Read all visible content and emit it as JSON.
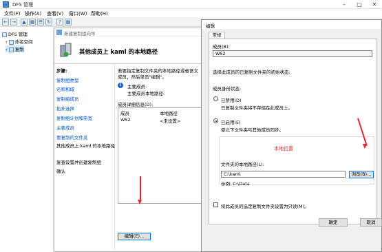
{
  "app": {
    "title": "DFS 管理",
    "menu": [
      "文件(F)",
      "操作(A)",
      "查看(V)",
      "窗口(W)",
      "帮助(H)"
    ]
  },
  "tree": {
    "root": "DFS 管理",
    "children": [
      "命名空间",
      "复制"
    ]
  },
  "wizard": {
    "window_title": "新建复制组向导",
    "heading": "其他成员上 kaml 的本地路径",
    "steps_header": "步骤:",
    "steps": [
      "复制组类型",
      "名称和域",
      "复制组成员",
      "拓扑选择",
      "复制组计划和带宽",
      "主要成员",
      "要复制的文件夹",
      "其他成员上 kaml 的本地路径",
      "复查设置并创建复制组",
      "确认"
    ],
    "intro_line1": "若要指定复制文件夹的本地路径或者该文",
    "intro_line2": "成员，然后单击\"编辑\"。",
    "info_line1": "主要成员:",
    "info_line2": "主要成员本地路径:",
    "details_label": "成员详细信息(D):",
    "columns": [
      "成员",
      "本地路径"
    ],
    "rows": [
      [
        "WS2",
        "<未设置>"
      ]
    ],
    "edit_button": "编辑(E)..."
  },
  "dialog": {
    "title": "编辑",
    "tab": "常规",
    "member_label": "成员(B):",
    "member_value": "WS2",
    "initial_status_hint": "选择此成员的已复制文件夹的初始状态:",
    "status_label": "成员身份状态:",
    "disabled_label": "已禁用(D)",
    "disabled_desc": "已复制文件夹将不存储在此成员上。",
    "enabled_label": "已启用(E)",
    "enabled_desc": "使以下文件夹与其他成员同步。",
    "local_path_label": "文件夹的本地路径(L):",
    "local_path_value": "C:\\kaml",
    "example": "示例: C:\\Data",
    "browse_button": "浏览(B)...",
    "readonly_label": "将此成员的选定复制文件夹设置为只读(M)。",
    "ok_button": "确定",
    "cancel_button": "取消"
  },
  "annotation": {
    "text": "本地位置",
    "color": "#e8242e"
  }
}
